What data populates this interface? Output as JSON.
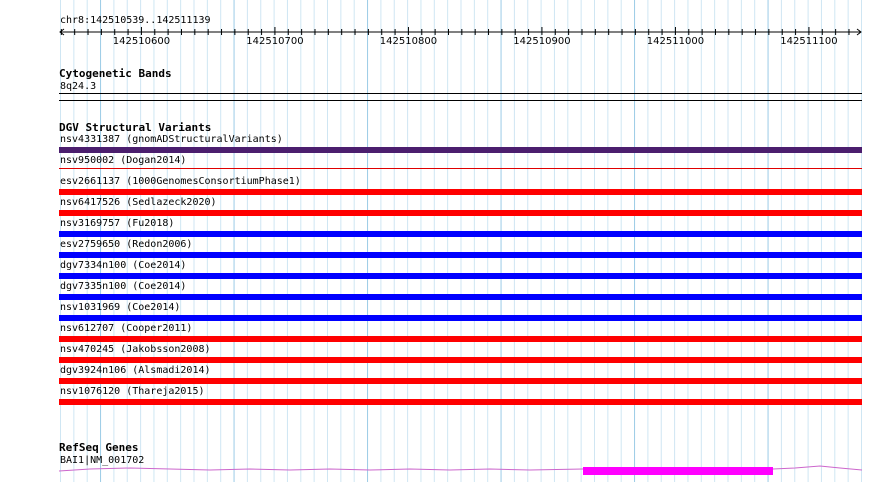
{
  "ruler": {
    "location": "chr8:142510539..142511139",
    "ticks": [
      "142510600",
      "142510700",
      "142510800",
      "142510900",
      "142511000",
      "142511100"
    ]
  },
  "cytoband": {
    "title": "Cytogenetic Bands",
    "band": "8q24.3"
  },
  "dgv": {
    "title": "DGV Structural Variants",
    "variants": [
      {
        "label": "nsv4331387 (gnomADStructuralVariants)",
        "color": "#4b1e6e"
      },
      {
        "label": "nsv950002 (Dogan2014)",
        "color": "#e00000"
      },
      {
        "label": "esv2661137 (1000GenomesConsortiumPhase1)",
        "color": "#ff0000"
      },
      {
        "label": "nsv6417526 (Sedlazeck2020)",
        "color": "#ff0000"
      },
      {
        "label": "nsv3169757 (Fu2018)",
        "color": "#0000ff"
      },
      {
        "label": "esv2759650 (Redon2006)",
        "color": "#0000ff"
      },
      {
        "label": "dgv7334n100 (Coe2014)",
        "color": "#0000ff"
      },
      {
        "label": "dgv7335n100 (Coe2014)",
        "color": "#0000ff"
      },
      {
        "label": "nsv1031969 (Coe2014)",
        "color": "#0000ff"
      },
      {
        "label": "nsv612707 (Cooper2011)",
        "color": "#ff0000"
      },
      {
        "label": "nsv470245 (Jakobsson2008)",
        "color": "#ff0000"
      },
      {
        "label": "dgv3924n106 (Alsmadi2014)",
        "color": "#ff0000"
      },
      {
        "label": "nsv1076120 (Thareja2015)",
        "color": "#ff0000"
      }
    ]
  },
  "refseq": {
    "title": "RefSeq Genes",
    "gene": "BAI1|NM_001702",
    "exon_color": "#ff00ff",
    "intron_color": "#cc66cc"
  },
  "colors": {
    "grid_light": "#cfe6f3",
    "grid_major": "#9ccbe6"
  }
}
